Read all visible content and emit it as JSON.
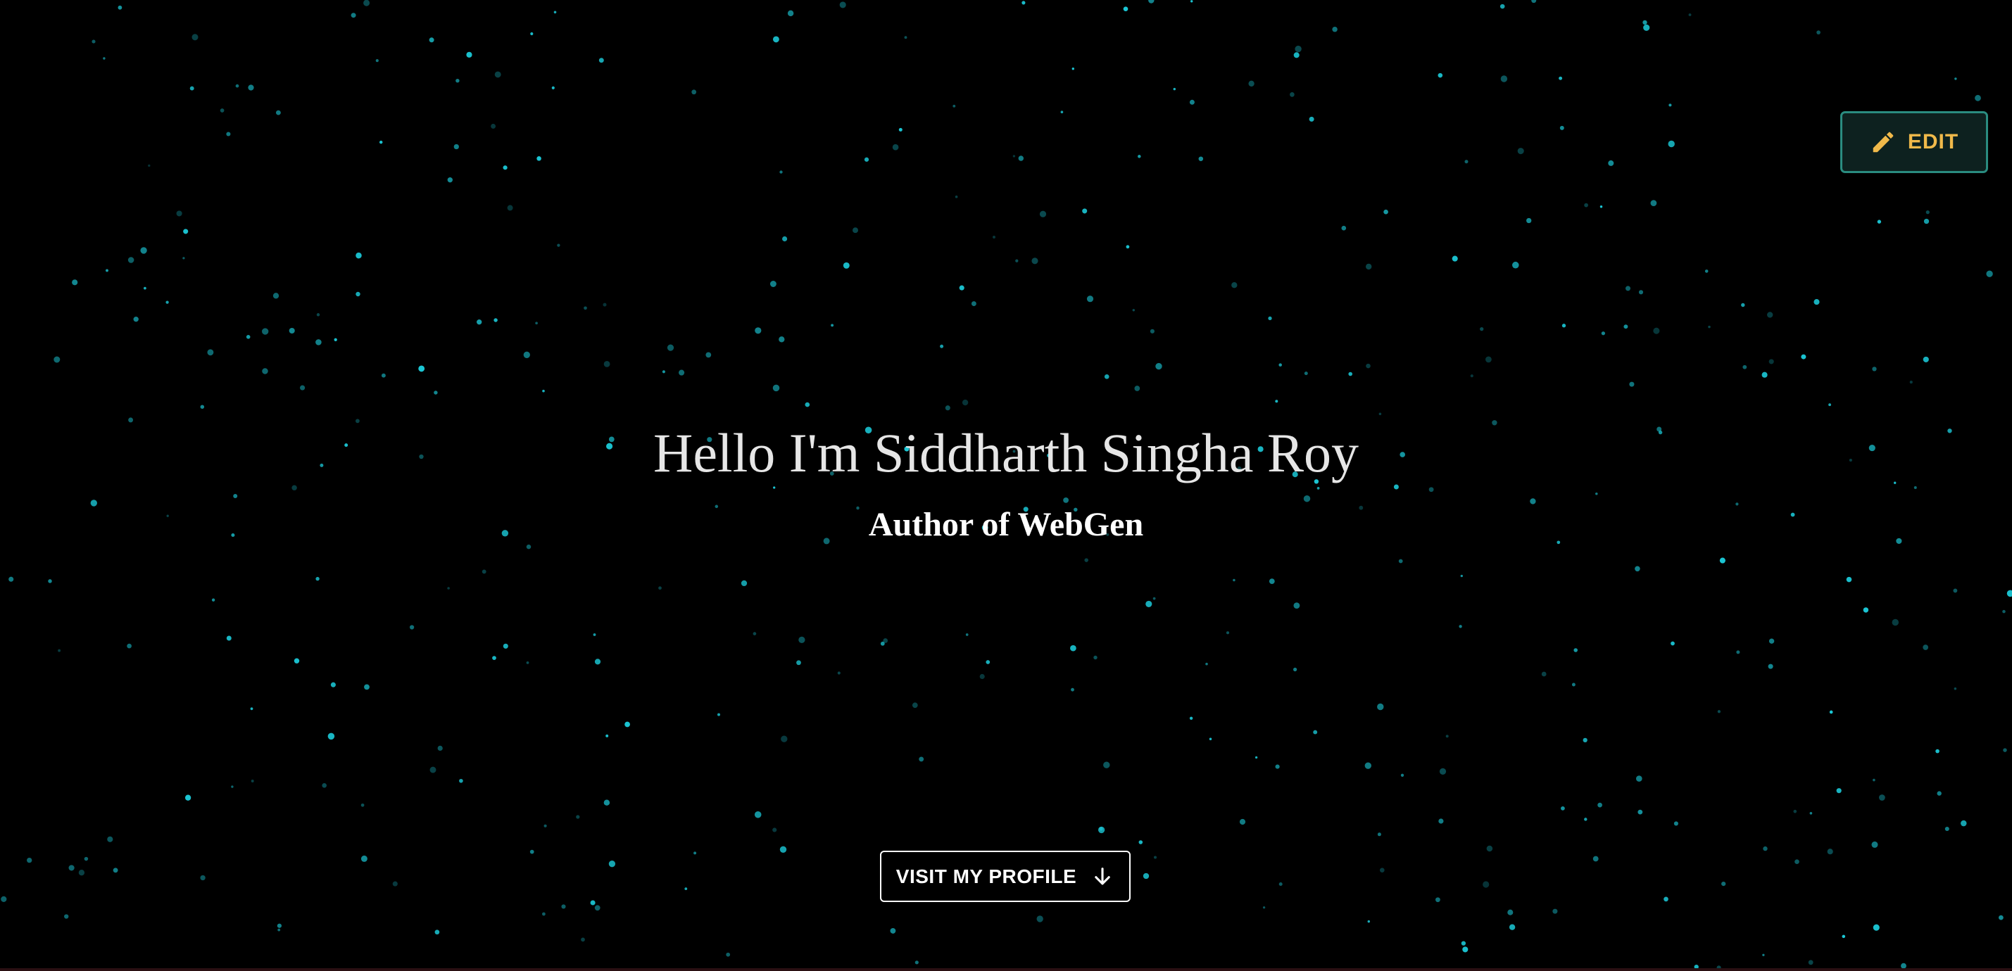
{
  "header": {
    "edit_label": "EDIT",
    "edit_icon": "pencil-icon"
  },
  "hero": {
    "headline": "Hello I'm Siddharth Singha Roy",
    "subtitle": "Author of WebGen",
    "cta_label": "VISIT MY PROFILE",
    "cta_icon": "arrow-down-icon"
  },
  "colors": {
    "background": "#000000",
    "star": "#1bc6d4",
    "edit_accent": "#f0b94a",
    "edit_border": "#2a8c80",
    "edit_bg": "#0d211f",
    "headline": "#e6e6e6",
    "subtitle": "#ffffff",
    "cta_text": "#ffffff"
  },
  "background": {
    "effect": "starfield-particles"
  }
}
